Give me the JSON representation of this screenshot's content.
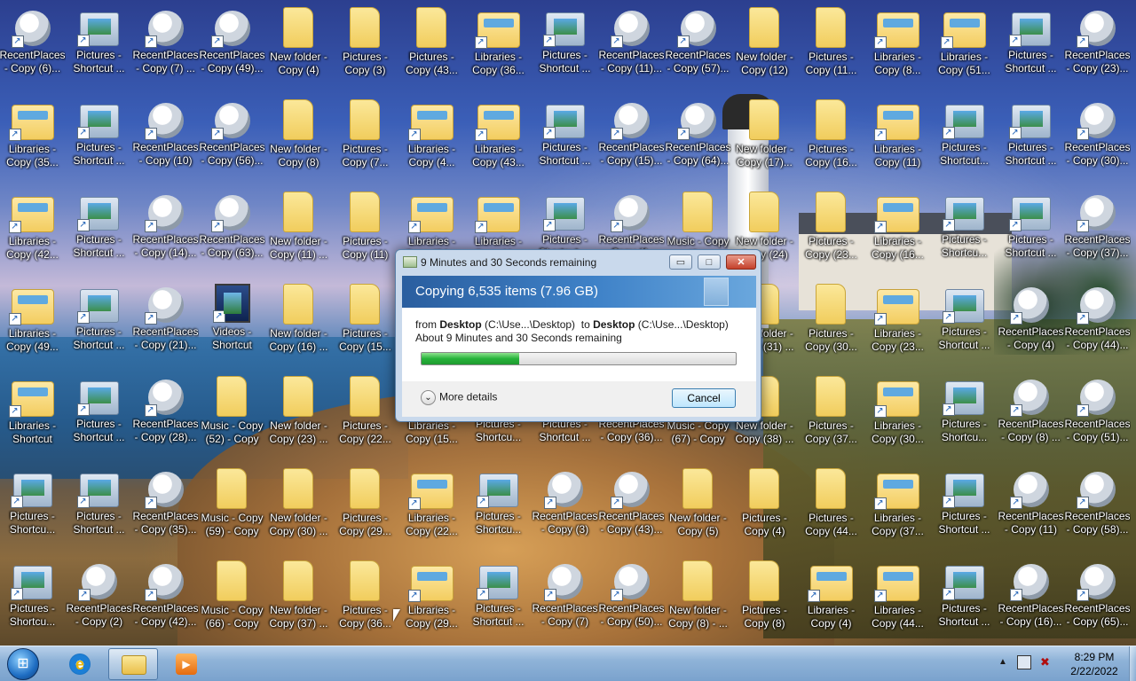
{
  "desktop": {
    "icons": [
      {
        "label": "RecentPlaces - Copy (6)...",
        "type": "recent"
      },
      {
        "label": "Pictures - Shortcut ...",
        "type": "pictures"
      },
      {
        "label": "RecentPlaces - Copy (7) ...",
        "type": "recent"
      },
      {
        "label": "RecentPlaces - Copy (49)...",
        "type": "recent"
      },
      {
        "label": "New folder - Copy (4)",
        "type": "folder"
      },
      {
        "label": "Pictures - Copy (3)",
        "type": "folder"
      },
      {
        "label": "Pictures - Copy (43...",
        "type": "folder"
      },
      {
        "label": "Libraries - Copy (36...",
        "type": "libraries"
      },
      {
        "label": "Pictures - Shortcut ...",
        "type": "pictures"
      },
      {
        "label": "RecentPlaces - Copy (11)...",
        "type": "recent"
      },
      {
        "label": "RecentPlaces - Copy (57)...",
        "type": "recent"
      },
      {
        "label": "New folder - Copy (12)",
        "type": "folder"
      },
      {
        "label": "Pictures - Copy (11...",
        "type": "folder"
      },
      {
        "label": "Libraries - Copy (8...",
        "type": "libraries"
      },
      {
        "label": "Libraries - Copy (51...",
        "type": "libraries"
      },
      {
        "label": "Pictures - Shortcut ...",
        "type": "pictures"
      },
      {
        "label": "RecentPlaces - Copy (23)...",
        "type": "recent"
      },
      {
        "label": "Libraries - Copy (35...",
        "type": "libraries"
      },
      {
        "label": "Pictures - Shortcut ...",
        "type": "pictures"
      },
      {
        "label": "RecentPlaces - Copy (10)",
        "type": "recent"
      },
      {
        "label": "RecentPlaces - Copy (56)...",
        "type": "recent"
      },
      {
        "label": "New folder - Copy (8)",
        "type": "folder"
      },
      {
        "label": "Pictures - Copy (7...",
        "type": "folder"
      },
      {
        "label": "Libraries - Copy (4...",
        "type": "libraries"
      },
      {
        "label": "Libraries - Copy (43...",
        "type": "libraries"
      },
      {
        "label": "Pictures - Shortcut ...",
        "type": "pictures"
      },
      {
        "label": "RecentPlaces - Copy (15)...",
        "type": "recent"
      },
      {
        "label": "RecentPlaces - Copy (64)...",
        "type": "recent"
      },
      {
        "label": "New folder - Copy (17)...",
        "type": "folder"
      },
      {
        "label": "Pictures - Copy (16...",
        "type": "folder"
      },
      {
        "label": "Libraries - Copy (11)",
        "type": "libraries"
      },
      {
        "label": "Pictures - Shortcut...",
        "type": "pictures"
      },
      {
        "label": "Pictures - Shortcut ...",
        "type": "pictures"
      },
      {
        "label": "RecentPlaces - Copy (30)...",
        "type": "recent"
      },
      {
        "label": "Libraries - Copy (42...",
        "type": "libraries"
      },
      {
        "label": "Pictures - Shortcut ...",
        "type": "pictures"
      },
      {
        "label": "RecentPlaces - Copy (14)...",
        "type": "recent"
      },
      {
        "label": "RecentPlaces - Copy (63)...",
        "type": "recent"
      },
      {
        "label": "New folder - Copy (11) ...",
        "type": "folder"
      },
      {
        "label": "Pictures - Copy (11)",
        "type": "folder"
      },
      {
        "label": "Libraries - Copy (24...",
        "type": "libraries"
      },
      {
        "label": "Libraries - Copy (4...",
        "type": "libraries"
      },
      {
        "label": "Pictures - Shortcut ...",
        "type": "pictures"
      },
      {
        "label": "RecentPlaces - Copy (1...",
        "type": "recent"
      },
      {
        "label": "Music - Copy (6...",
        "type": "music"
      },
      {
        "label": "New folder - Copy (24)",
        "type": "folder"
      },
      {
        "label": "Pictures - Copy (23...",
        "type": "folder"
      },
      {
        "label": "Libraries - Copy (16...",
        "type": "libraries"
      },
      {
        "label": "Pictures - Shortcu...",
        "type": "pictures"
      },
      {
        "label": "Pictures - Shortcut ...",
        "type": "pictures"
      },
      {
        "label": "RecentPlaces - Copy (37)...",
        "type": "recent"
      },
      {
        "label": "Libraries - Copy (49...",
        "type": "libraries"
      },
      {
        "label": "Pictures - Shortcut ...",
        "type": "pictures"
      },
      {
        "label": "RecentPlaces - Copy (21)...",
        "type": "recent"
      },
      {
        "label": "Videos - Shortcut",
        "type": "videos"
      },
      {
        "label": "New folder - Copy (16) ...",
        "type": "folder"
      },
      {
        "label": "Pictures - Copy (15...",
        "type": "folder"
      },
      {
        "label": "Libraries - Copy (2...",
        "type": "libraries"
      },
      {
        "label": "Libraries - Copy (3...",
        "type": "libraries"
      },
      {
        "label": "Pictures - Shortcut ...",
        "type": "pictures"
      },
      {
        "label": "RecentPlaces - Copy (2...",
        "type": "recent"
      },
      {
        "label": "Music - Copy (4...",
        "type": "music"
      },
      {
        "label": "New folder - Copy (31) ...",
        "type": "folder"
      },
      {
        "label": "Pictures - Copy (30...",
        "type": "folder"
      },
      {
        "label": "Libraries - Copy (23...",
        "type": "libraries"
      },
      {
        "label": "Pictures - Shortcut ...",
        "type": "pictures"
      },
      {
        "label": "RecentPlaces - Copy (4)",
        "type": "recent"
      },
      {
        "label": "RecentPlaces - Copy (44)...",
        "type": "recent"
      },
      {
        "label": "Libraries - Shortcut",
        "type": "libraries"
      },
      {
        "label": "Pictures - Shortcut ...",
        "type": "pictures"
      },
      {
        "label": "RecentPlaces - Copy (28)...",
        "type": "recent"
      },
      {
        "label": "Music - Copy (52) - Copy",
        "type": "music"
      },
      {
        "label": "New folder - Copy (23) ...",
        "type": "folder"
      },
      {
        "label": "Pictures - Copy (22...",
        "type": "folder"
      },
      {
        "label": "Libraries - Copy (15...",
        "type": "libraries"
      },
      {
        "label": "Pictures - Shortcu...",
        "type": "pictures"
      },
      {
        "label": "Pictures - Shortcut ...",
        "type": "pictures"
      },
      {
        "label": "RecentPlaces - Copy (36)...",
        "type": "recent"
      },
      {
        "label": "Music - Copy (67) - Copy",
        "type": "music"
      },
      {
        "label": "New folder - Copy (38) ...",
        "type": "folder"
      },
      {
        "label": "Pictures - Copy (37...",
        "type": "folder"
      },
      {
        "label": "Libraries - Copy (30...",
        "type": "libraries"
      },
      {
        "label": "Pictures - Shortcu...",
        "type": "pictures"
      },
      {
        "label": "RecentPlaces - Copy (8) ...",
        "type": "recent"
      },
      {
        "label": "RecentPlaces - Copy (51)...",
        "type": "recent"
      },
      {
        "label": "Pictures - Shortcu...",
        "type": "pictures"
      },
      {
        "label": "Pictures - Shortcut ...",
        "type": "pictures"
      },
      {
        "label": "RecentPlaces - Copy (35)...",
        "type": "recent"
      },
      {
        "label": "Music - Copy (59) - Copy",
        "type": "music"
      },
      {
        "label": "New folder - Copy (30) ...",
        "type": "folder"
      },
      {
        "label": "Pictures - Copy (29...",
        "type": "folder"
      },
      {
        "label": "Libraries - Copy (22...",
        "type": "libraries"
      },
      {
        "label": "Pictures - Shortcu...",
        "type": "pictures"
      },
      {
        "label": "RecentPlaces - Copy (3)",
        "type": "recent"
      },
      {
        "label": "RecentPlaces - Copy (43)...",
        "type": "recent"
      },
      {
        "label": "New folder - Copy (5)",
        "type": "folder"
      },
      {
        "label": "Pictures - Copy (4)",
        "type": "folder"
      },
      {
        "label": "Pictures - Copy (44...",
        "type": "folder"
      },
      {
        "label": "Libraries - Copy (37...",
        "type": "libraries"
      },
      {
        "label": "Pictures - Shortcut ...",
        "type": "pictures"
      },
      {
        "label": "RecentPlaces - Copy (11)",
        "type": "recent"
      },
      {
        "label": "RecentPlaces - Copy (58)...",
        "type": "recent"
      },
      {
        "label": "Pictures - Shortcu...",
        "type": "pictures"
      },
      {
        "label": "RecentPlaces - Copy (2)",
        "type": "recent"
      },
      {
        "label": "RecentPlaces - Copy (42)...",
        "type": "recent"
      },
      {
        "label": "Music - Copy (66) - Copy",
        "type": "music"
      },
      {
        "label": "New folder - Copy (37) ...",
        "type": "folder"
      },
      {
        "label": "Pictures - Copy (36...",
        "type": "folder"
      },
      {
        "label": "Libraries - Copy (29...",
        "type": "libraries"
      },
      {
        "label": "Pictures - Shortcut ...",
        "type": "pictures"
      },
      {
        "label": "RecentPlaces - Copy (7)",
        "type": "recent"
      },
      {
        "label": "RecentPlaces - Copy (50)...",
        "type": "recent"
      },
      {
        "label": "New folder - Copy (8) - ...",
        "type": "folder"
      },
      {
        "label": "Pictures - Copy (8)",
        "type": "folder"
      },
      {
        "label": "Libraries - Copy (4)",
        "type": "libraries"
      },
      {
        "label": "Libraries - Copy (44...",
        "type": "libraries"
      },
      {
        "label": "Pictures - Shortcut ...",
        "type": "pictures"
      },
      {
        "label": "RecentPlaces - Copy (16)...",
        "type": "recent"
      },
      {
        "label": "RecentPlaces - Copy (65)...",
        "type": "recent"
      }
    ]
  },
  "dialog": {
    "title": "9 Minutes and 30 Seconds remaining",
    "heading": "Copying 6,535 items (7.96 GB)",
    "from_word": "from",
    "from_name": "Desktop",
    "from_path": "(C:\\Use...\\Desktop)",
    "to_word": "to",
    "to_name": "Desktop",
    "to_path": "(C:\\Use...\\Desktop)",
    "remaining": "About 9 Minutes and 30 Seconds remaining",
    "progress_percent": 31,
    "more_details": "More details",
    "cancel": "Cancel",
    "buttons": {
      "minimize": "▭",
      "maximize": "□",
      "close": "✕"
    }
  },
  "taskbar": {
    "start_icon": "windows-orb-icon",
    "pinned": [
      {
        "name": "internet-explorer-icon",
        "glyph": "e"
      },
      {
        "name": "windows-explorer-icon",
        "glyph": ""
      },
      {
        "name": "windows-media-player-icon",
        "glyph": "▶"
      }
    ],
    "tray": {
      "show_hidden": "▲",
      "volume": "✖"
    },
    "clock": {
      "time": "8:29 PM",
      "date": "2/22/2022"
    }
  },
  "colors": {
    "progress_green": "#26b33a",
    "title_bar": "#c9d9ec",
    "header_blue": "#2a5e9f"
  }
}
